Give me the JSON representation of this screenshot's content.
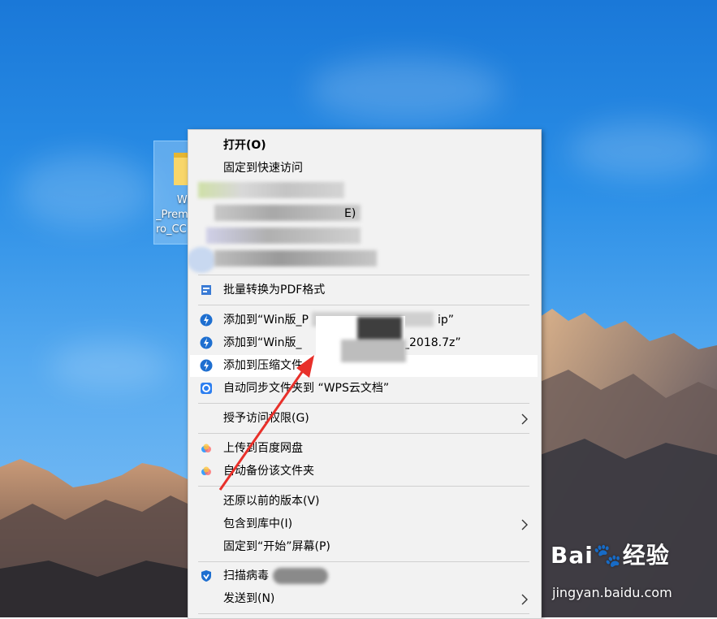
{
  "desktop": {
    "folder_label": "Wi\n_Prem\nro_CC"
  },
  "menu": {
    "items": [
      {
        "label": "打开(O)"
      },
      {
        "label": "固定到快速访问"
      },
      {
        "label": "E)"
      },
      {
        "label": "批量转换为PDF格式"
      },
      {
        "label": "添加到“Win版_P",
        "label_tail": "ip”"
      },
      {
        "label": "添加到“Win版_",
        "label_tail": "_2018.7z”"
      },
      {
        "label": "添加到压缩文件"
      },
      {
        "label": "自动同步文件夹到 “WPS云文档”"
      },
      {
        "label": "授予访问权限(G)"
      },
      {
        "label": "上传到百度网盘"
      },
      {
        "label": "自动备份该文件夹"
      },
      {
        "label": "还原以前的版本(V)"
      },
      {
        "label": "包含到库中(I)"
      },
      {
        "label": "固定到“开始”屏幕(P)"
      },
      {
        "label": "扫描病毒"
      },
      {
        "label": "发送到(N)"
      }
    ]
  },
  "watermark": {
    "logo": "Bai🐾经验",
    "url": "jingyan.baidu.com"
  },
  "colors": {
    "menu_bg": "#f2f2f2",
    "highlight": "#ffffff",
    "arrow_annotation": "#e8302a",
    "sky": "#2a8ee6"
  }
}
